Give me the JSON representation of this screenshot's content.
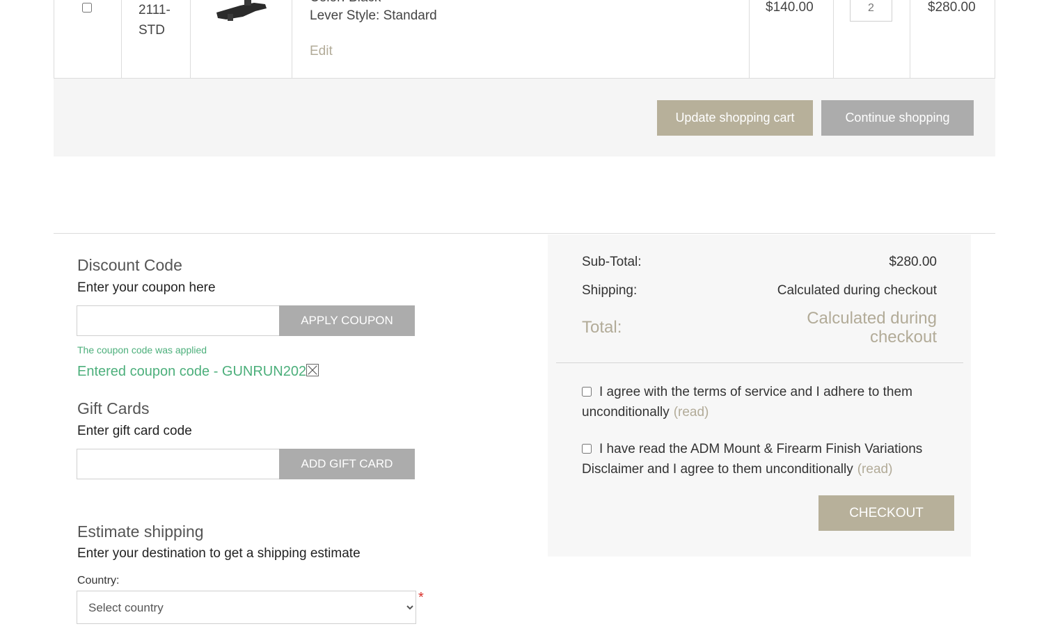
{
  "cart_row": {
    "sku": "2111-STD",
    "attribute_color": "Color: Black",
    "attribute_lever": "Lever Style: Standard",
    "edit_label": "Edit",
    "unit_price": "$140.00",
    "quantity": "2",
    "line_total": "$280.00"
  },
  "cart_actions": {
    "update_label": "Update shopping cart",
    "continue_label": "Continue shopping"
  },
  "discount": {
    "title": "Discount Code",
    "subtitle": "Enter your coupon here",
    "button_label": "APPLY COUPON",
    "success_message": "The coupon code was applied",
    "entered_code": "Entered coupon code - GUNRUN2025"
  },
  "gift_cards": {
    "title": "Gift Cards",
    "subtitle": "Enter gift card code",
    "button_label": "ADD GIFT CARD"
  },
  "estimate_shipping": {
    "title": "Estimate shipping",
    "subtitle": "Enter your destination to get a shipping estimate",
    "country_label": "Country:",
    "country_placeholder": "Select country",
    "required_mark": "*"
  },
  "totals": {
    "subtotal_label": "Sub-Total:",
    "subtotal_value": "$280.00",
    "shipping_label": "Shipping:",
    "shipping_value": "Calculated during checkout",
    "total_label": "Total:",
    "total_value": "Calculated during checkout"
  },
  "agreements": {
    "terms_text": "I agree with the terms of service and I adhere to them unconditionally",
    "terms_read": "(read)",
    "disclaimer_text": "I have read the ADM Mount & Firearm Finish Variations Disclaimer and I agree to them unconditionally",
    "disclaimer_read": "(read)"
  },
  "checkout_label": "CHECKOUT",
  "colors": {
    "accent": "#b7b09a",
    "gray_button": "#acacac",
    "success": "#4caf7b",
    "required": "#d9312b"
  }
}
